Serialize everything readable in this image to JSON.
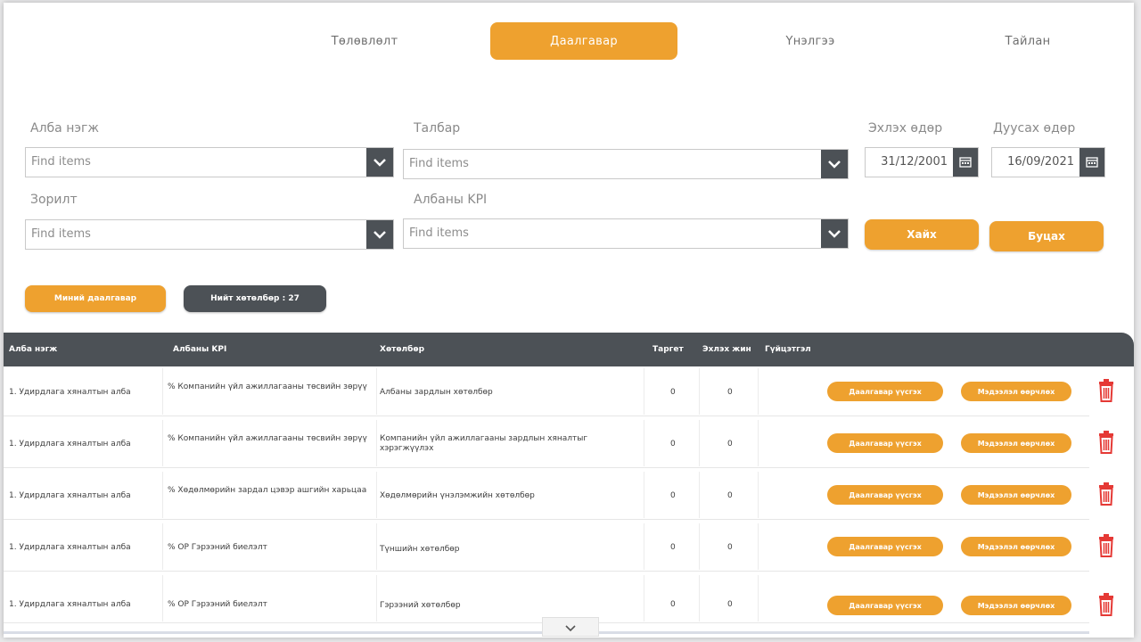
{
  "tabs": [
    {
      "label": "Төлөвлөлт"
    },
    {
      "label": "Даалгавар"
    },
    {
      "label": "Үнэлгээ"
    },
    {
      "label": "Тайлан"
    }
  ],
  "filters": {
    "unit_label": "Алба нэгж",
    "unit_placeholder": "Find items",
    "field_label": "Талбар",
    "field_placeholder": "Find items",
    "start_label": "Эхлэх өдөр",
    "start_value": "31/12/2001",
    "end_label": "Дуусах өдөр",
    "end_value": "16/09/2021",
    "goal_label": "Зорилт",
    "goal_placeholder": "Find items",
    "kpi_label": "Албаны KPI",
    "kpi_placeholder": "Find items",
    "search_label": "Хайх",
    "back_label": "Буцах"
  },
  "toolbar": {
    "my_tasks_label": "Миний даалгавар",
    "total_label": "Нийт хөтөлбөр : 27"
  },
  "table": {
    "headers": [
      "Алба нэгж",
      "Албаны KPI",
      "Хөтөлбөр",
      "Таргет",
      "Эхлэх жин",
      "Гүйцэтгэл"
    ],
    "action_labels": {
      "create_task": "Даалгавар үүсгэх",
      "edit_info": "Мэдээлэл өөрчлөх"
    },
    "rows": [
      {
        "unit": "1. Удирдлага хяналтын алба",
        "kpi": "% Компанийн үйл ажиллагааны төсвийн зөрүү",
        "program": "Албаны зардлын хөтөлбөр",
        "target": "0",
        "weight": "0"
      },
      {
        "unit": "1. Удирдлага хяналтын алба",
        "kpi": "% Компанийн үйл ажиллагааны төсвийн зөрүү",
        "program": "Компанийн үйл ажиллагааны зардлын хяналтыг хэрэгжүүлэх",
        "target": "0",
        "weight": "0"
      },
      {
        "unit": "1. Удирдлага хяналтын алба",
        "kpi": "% Хөдөлмөрийн зардал цэвэр ашгийн харьцаа",
        "program": "Хөдөлмөрийн үнэлэмжийн хөтөлбөр",
        "target": "0",
        "weight": "0"
      },
      {
        "unit": "1. Удирдлага хяналтын алба",
        "kpi": "% OP Гэрээний биелэлт",
        "program": "Түншийн хөтөлбөр",
        "target": "0",
        "weight": "0"
      },
      {
        "unit": "1. Удирдлага хяналтын алба",
        "kpi": "% OP Гэрээний биелэлт",
        "program": "Гэрээний хөтөлбөр",
        "target": "0",
        "weight": "0"
      }
    ]
  },
  "colors": {
    "accent": "#eea12f",
    "dark": "#4c5156",
    "delete": "#e53935"
  },
  "icons": {
    "dropdown": "chevron-down-icon",
    "calendar": "calendar-icon",
    "delete": "trash-icon",
    "scroll": "chevron-down-icon"
  }
}
